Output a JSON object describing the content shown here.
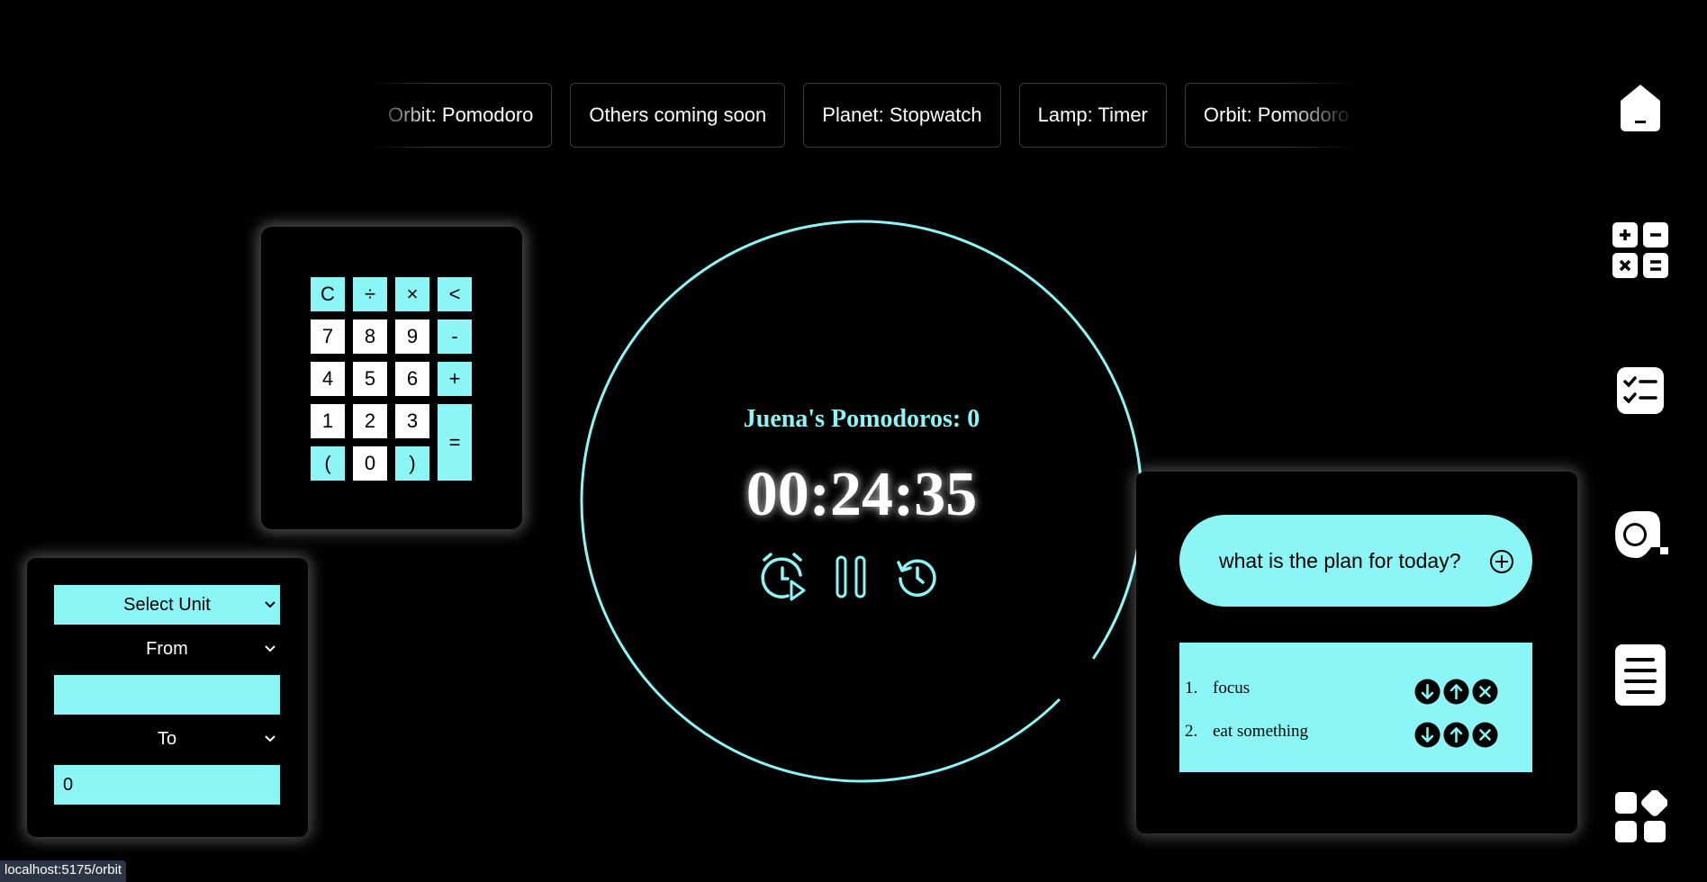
{
  "carousel": {
    "chips": [
      "Orbit: Pomodoro",
      "Others coming soon",
      "Planet: Stopwatch",
      "Lamp: Timer",
      "Orbit: Pomodoro"
    ]
  },
  "right_nav": {
    "items": [
      {
        "icon": "home-icon"
      },
      {
        "icon": "calculator-icon"
      },
      {
        "icon": "checklist-icon"
      },
      {
        "icon": "tape-measure-icon"
      },
      {
        "icon": "notes-icon"
      },
      {
        "icon": "apps-icon"
      }
    ]
  },
  "calculator": {
    "keys": [
      {
        "label": "C",
        "kind": "op"
      },
      {
        "label": "÷",
        "kind": "op"
      },
      {
        "label": "×",
        "kind": "op"
      },
      {
        "label": "<",
        "kind": "op"
      },
      {
        "label": "7",
        "kind": "num"
      },
      {
        "label": "8",
        "kind": "num"
      },
      {
        "label": "9",
        "kind": "num"
      },
      {
        "label": "-",
        "kind": "op"
      },
      {
        "label": "4",
        "kind": "num"
      },
      {
        "label": "5",
        "kind": "num"
      },
      {
        "label": "6",
        "kind": "num"
      },
      {
        "label": "+",
        "kind": "op"
      },
      {
        "label": "1",
        "kind": "num"
      },
      {
        "label": "2",
        "kind": "num"
      },
      {
        "label": "3",
        "kind": "num"
      },
      {
        "label": "=",
        "kind": "eq"
      },
      {
        "label": "(",
        "kind": "op"
      },
      {
        "label": "0",
        "kind": "num"
      },
      {
        "label": ")",
        "kind": "op"
      }
    ],
    "accent": "#8cf5f5"
  },
  "converter": {
    "unit_select": "Select Unit",
    "from_select": "From",
    "from_value": "",
    "to_select": "To",
    "to_value": "0"
  },
  "timer": {
    "title": "Juena's Pomodoros: 0",
    "time": "00:24:35",
    "controls": [
      "alarm-play-icon",
      "pause-icon",
      "history-icon"
    ],
    "progress_fraction": 0.95
  },
  "todo": {
    "placeholder": "what is the plan for today?",
    "items": [
      {
        "index": "1.",
        "text": "focus"
      },
      {
        "index": "2.",
        "text": "eat something"
      }
    ]
  },
  "status_bar": {
    "url": "localhost:5175/orbit"
  },
  "colors": {
    "accent": "#8cf5f5",
    "background": "#000000"
  }
}
